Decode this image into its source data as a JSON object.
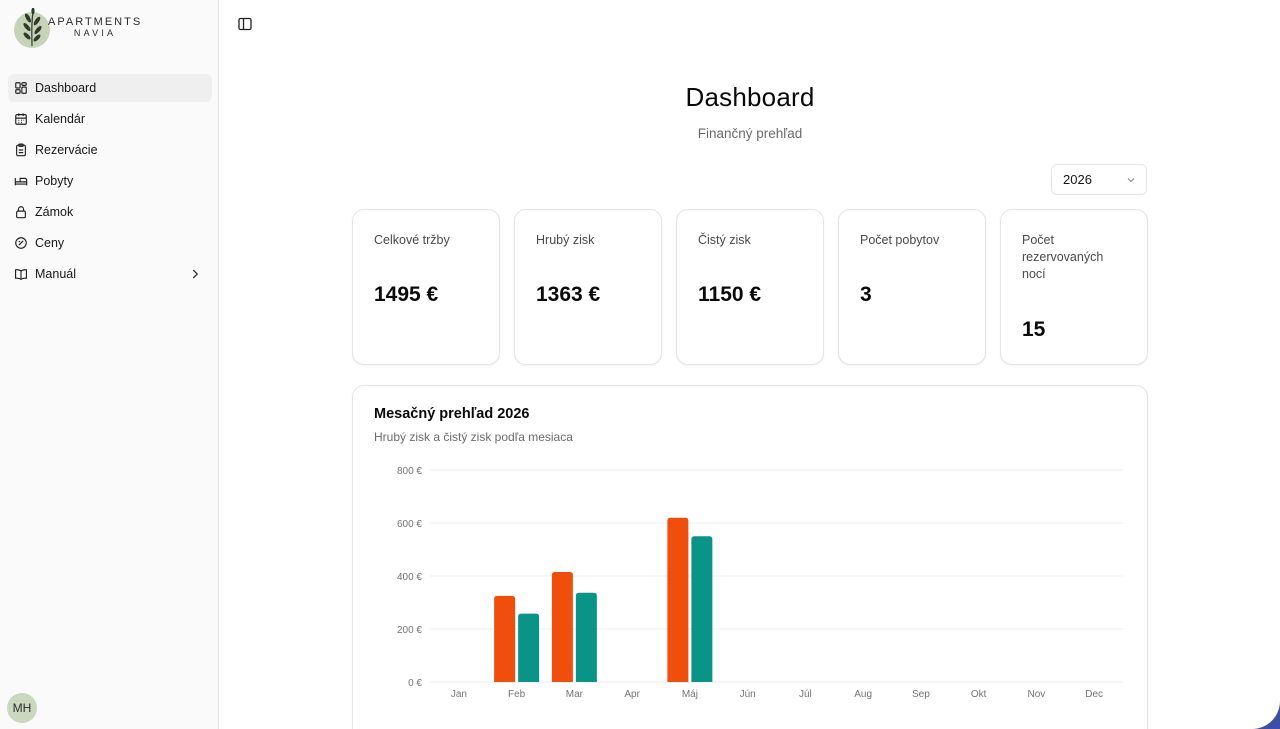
{
  "brand": {
    "line1": "APARTMENTS",
    "line2": "NAVIA"
  },
  "sidebar": {
    "items": [
      {
        "label": "Dashboard",
        "icon": "dashboard-icon",
        "active": true
      },
      {
        "label": "Kalendár",
        "icon": "calendar-icon"
      },
      {
        "label": "Rezervácie",
        "icon": "clipboard-icon"
      },
      {
        "label": "Pobyty",
        "icon": "bed-icon"
      },
      {
        "label": "Zámok",
        "icon": "lock-icon"
      },
      {
        "label": "Ceny",
        "icon": "gauge-icon"
      },
      {
        "label": "Manuál",
        "icon": "book-icon",
        "expandable": true
      }
    ],
    "user_initials": "MH"
  },
  "header": {
    "title": "Dashboard",
    "subtitle": "Finančný prehľad"
  },
  "year_select": {
    "value": "2026"
  },
  "stats": [
    {
      "label": "Celkové tržby",
      "value": "1495 €"
    },
    {
      "label": "Hrubý zisk",
      "value": "1363 €"
    },
    {
      "label": "Čistý zisk",
      "value": "1150 €"
    },
    {
      "label": "Počet pobytov",
      "value": "3"
    },
    {
      "label": "Počet rezervovaných nocí",
      "value": "15"
    }
  ],
  "chart_card": {
    "title": "Mesačný prehľad 2026",
    "subtitle": "Hrubý zisk a čistý zisk podľa mesiaca"
  },
  "colors": {
    "gross": "#f04e0c",
    "net": "#0a9488",
    "grid": "#eeeeee"
  },
  "chart_data": {
    "type": "bar",
    "title": "",
    "xlabel": "",
    "ylabel": "",
    "categories": [
      "Jan",
      "Feb",
      "Mar",
      "Apr",
      "Máj",
      "Jún",
      "Júl",
      "Aug",
      "Sep",
      "Okt",
      "Nov",
      "Dec"
    ],
    "series": [
      {
        "values": [
          0,
          325,
          415,
          0,
          620,
          0,
          0,
          0,
          0,
          0,
          0,
          0
        ]
      },
      {
        "values": [
          0,
          258,
          337,
          0,
          550,
          0,
          0,
          0,
          0,
          0,
          0,
          0
        ]
      }
    ],
    "ylim": [
      0,
      800
    ],
    "yticks": [
      0,
      200,
      400,
      600,
      800
    ],
    "ytick_labels": [
      "0 €",
      "200 €",
      "400 €",
      "600 €",
      "800 €"
    ],
    "grid": true,
    "legend": "none"
  }
}
